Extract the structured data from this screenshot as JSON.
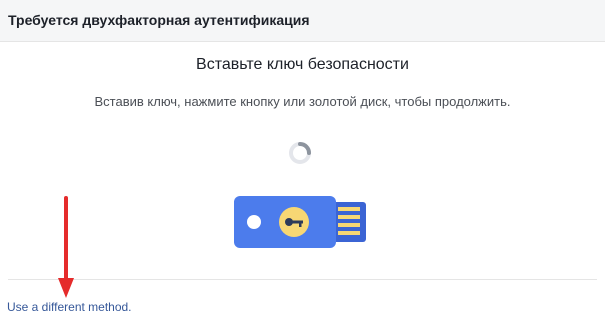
{
  "header": {
    "title": "Требуется двухфакторная аутентификация"
  },
  "main": {
    "title": "Вставьте ключ безопасности",
    "instruction": "Вставив ключ, нажмите кнопку или золотой диск, чтобы продолжить."
  },
  "footer": {
    "alt_method_link": "Use a different method."
  },
  "colors": {
    "header_bg": "#f5f6f7",
    "link": "#365899",
    "key_body": "#4c7cec",
    "key_disc": "#f7d774",
    "annotation_arrow": "#e52b2b"
  },
  "icons": {
    "spinner": "loading-spinner-icon",
    "key": "security-key-icon",
    "arrow": "red-arrow-down-icon"
  }
}
